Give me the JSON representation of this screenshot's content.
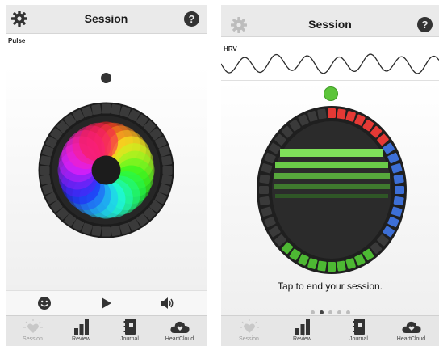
{
  "left": {
    "title": "Session",
    "wave_label": "Pulse",
    "pager_active": 0,
    "controls": {
      "mood": "smiley-icon",
      "play": "play-icon",
      "sound": "speaker-icon"
    }
  },
  "right": {
    "title": "Session",
    "wave_label": "HRV",
    "hint": "Tap to end your session.",
    "pager_active": 1
  },
  "tabs": [
    {
      "label": "Session",
      "icon": "heart-icon"
    },
    {
      "label": "Review",
      "icon": "bar-chart-icon"
    },
    {
      "label": "Journal",
      "icon": "journal-icon"
    },
    {
      "label": "HeartCloud",
      "icon": "cloud-icon"
    }
  ],
  "colors": {
    "coherence_green": "#4db833",
    "coherence_red": "#e53935",
    "coherence_blue": "#3d6fd6",
    "coherence_dark": "#2a2a2a"
  }
}
